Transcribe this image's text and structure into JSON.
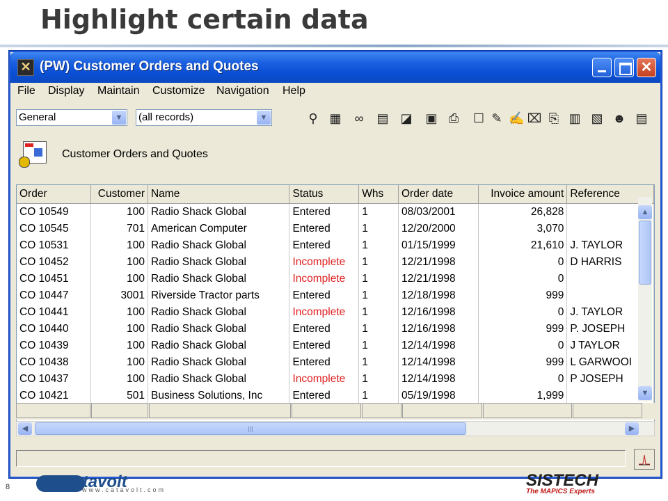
{
  "slide": {
    "title": "Highlight certain data",
    "page_number": "8",
    "logo_left": "catavolt",
    "logo_left_url": "www.catavolt.com",
    "logo_right": "SISTECH",
    "logo_right_tagline": "The MAPICS Experts"
  },
  "window": {
    "title": "(PW) Customer Orders and Quotes",
    "menu": [
      "File",
      "Display",
      "Maintain",
      "Customize",
      "Navigation",
      "Help"
    ],
    "view_combo": "General",
    "filter_combo": "(all records)",
    "header_label": "Customer Orders and Quotes"
  },
  "toolbar_icons": [
    "binoculars-icon",
    "window-find-icon",
    "glasses-icon",
    "form-icon",
    "note-icon",
    "print-preview-icon",
    "printer-icon",
    "new-document-icon",
    "pencil-icon",
    "edit-lines-icon",
    "delete-icon",
    "copy-icon",
    "export-icon",
    "import-icon",
    "user-icon",
    "table-icon"
  ],
  "grid": {
    "columns": [
      "Order",
      "Customer",
      "Name",
      "Status",
      "Whs",
      "Order date",
      "Invoice amount",
      "Reference"
    ],
    "rows": [
      {
        "order": "CO   10549",
        "customer": "100",
        "name": "Radio Shack Global",
        "status": "Entered",
        "whs": "1",
        "date": "08/03/2001",
        "amount": "26,828",
        "ref": ""
      },
      {
        "order": "CO   10545",
        "customer": "701",
        "name": "American Computer",
        "status": "Entered",
        "whs": "1",
        "date": "12/20/2000",
        "amount": "3,070",
        "ref": ""
      },
      {
        "order": "CO   10531",
        "customer": "100",
        "name": "Radio Shack Global",
        "status": "Entered",
        "whs": "1",
        "date": "01/15/1999",
        "amount": "21,610",
        "ref": "J. TAYLOR"
      },
      {
        "order": "CO   10452",
        "customer": "100",
        "name": "Radio Shack Global",
        "status": "Incomplete",
        "whs": "1",
        "date": "12/21/1998",
        "amount": "0",
        "ref": "D HARRIS"
      },
      {
        "order": "CO   10451",
        "customer": "100",
        "name": "Radio Shack Global",
        "status": "Incomplete",
        "whs": "1",
        "date": "12/21/1998",
        "amount": "0",
        "ref": ""
      },
      {
        "order": "CO   10447",
        "customer": "3001",
        "name": "Riverside Tractor parts",
        "status": "Entered",
        "whs": "1",
        "date": "12/18/1998",
        "amount": "999",
        "ref": ""
      },
      {
        "order": "CO   10441",
        "customer": "100",
        "name": "Radio Shack Global",
        "status": "Incomplete",
        "whs": "1",
        "date": "12/16/1998",
        "amount": "0",
        "ref": "J. TAYLOR"
      },
      {
        "order": "CO   10440",
        "customer": "100",
        "name": "Radio Shack Global",
        "status": "Entered",
        "whs": "1",
        "date": "12/16/1998",
        "amount": "999",
        "ref": "P. JOSEPH"
      },
      {
        "order": "CO   10439",
        "customer": "100",
        "name": "Radio Shack Global",
        "status": "Entered",
        "whs": "1",
        "date": "12/14/1998",
        "amount": "0",
        "ref": "J TAYLOR"
      },
      {
        "order": "CO   10438",
        "customer": "100",
        "name": "Radio Shack Global",
        "status": "Entered",
        "whs": "1",
        "date": "12/14/1998",
        "amount": "999",
        "ref": "L GARWOOI"
      },
      {
        "order": "CO   10437",
        "customer": "100",
        "name": "Radio Shack Global",
        "status": "Incomplete",
        "whs": "1",
        "date": "12/14/1998",
        "amount": "0",
        "ref": "P JOSEPH"
      },
      {
        "order": "CO   10421",
        "customer": "501",
        "name": "Business Solutions, Inc",
        "status": "Entered",
        "whs": "1",
        "date": "05/19/1998",
        "amount": "1,999",
        "ref": ""
      }
    ]
  },
  "colors": {
    "incomplete": "#e02020",
    "titlebar": "#0a4fd4"
  }
}
